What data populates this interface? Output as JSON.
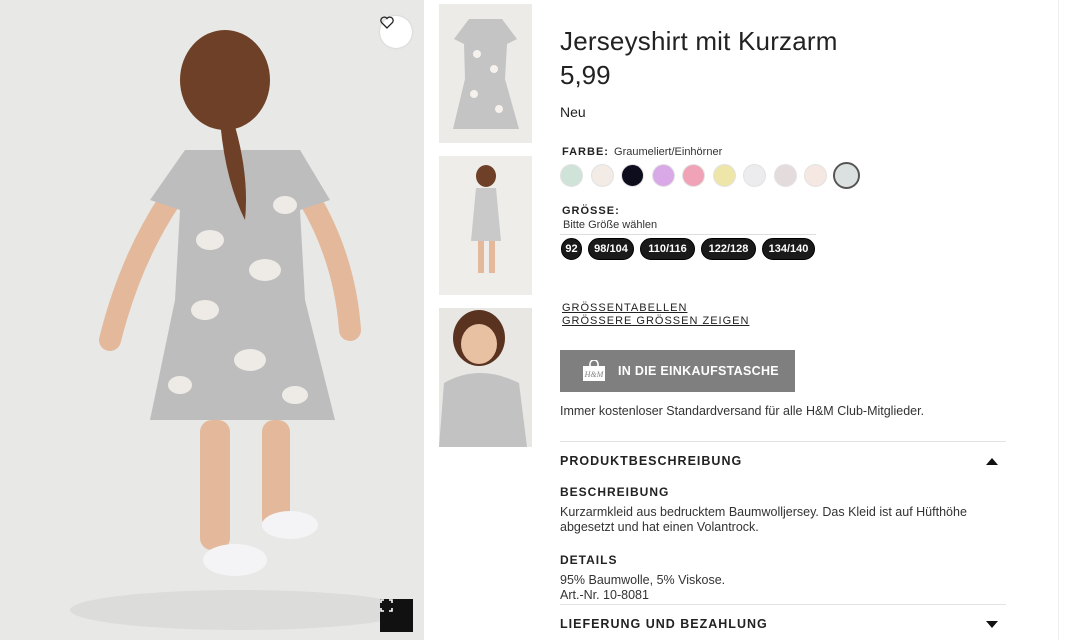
{
  "product": {
    "title": "Jerseyshirt mit Kurzarm",
    "price": "5,99",
    "badge": "Neu"
  },
  "color": {
    "label": "FARBE:",
    "selected_name": "Graumeliert/Einhörner",
    "swatches": [
      "#cfe3d8",
      "#f3ebe5",
      "#0d0d1e",
      "#d9a8e6",
      "#f0a2b6",
      "#eee6a8",
      "#ececef",
      "#e4dcdc",
      "#f5e7e2",
      "#dbe1e1"
    ]
  },
  "size": {
    "label": "GRÖSSE:",
    "hint": "Bitte Größe wählen",
    "options": [
      "92",
      "98/104",
      "110/116",
      "122/128",
      "134/140"
    ]
  },
  "links": {
    "size_tables": "GRÖSSENTABELLEN",
    "larger_sizes": "GRÖSSERE GRÖSSEN ZEIGEN"
  },
  "cart": {
    "button_label": "IN DIE EINKAUFSTASCHE",
    "icon_text": "H&M"
  },
  "shipping_note": "Immer kostenloser Standardversand für alle H&M Club-Mitglieder.",
  "description": {
    "section_title": "PRODUKTBESCHREIBUNG",
    "desc_heading": "BESCHREIBUNG",
    "desc_line1": "Kurzarmkleid aus bedrucktem Baumwolljersey. Das Kleid ist auf Hüfthöhe",
    "desc_line2": "abgesetzt und hat einen Volantrock.",
    "details_heading": "DETAILS",
    "details_line1": "95% Baumwolle, 5% Viskose.",
    "details_line2": "Art.-Nr. 10-8081"
  },
  "delivery": {
    "section_title": "LIEFERUNG UND BEZAHLUNG"
  },
  "colors": {
    "button_gray": "#7f7f7f",
    "size_pill": "#1a1a1a",
    "dress_gray": "#bdbdbd"
  }
}
